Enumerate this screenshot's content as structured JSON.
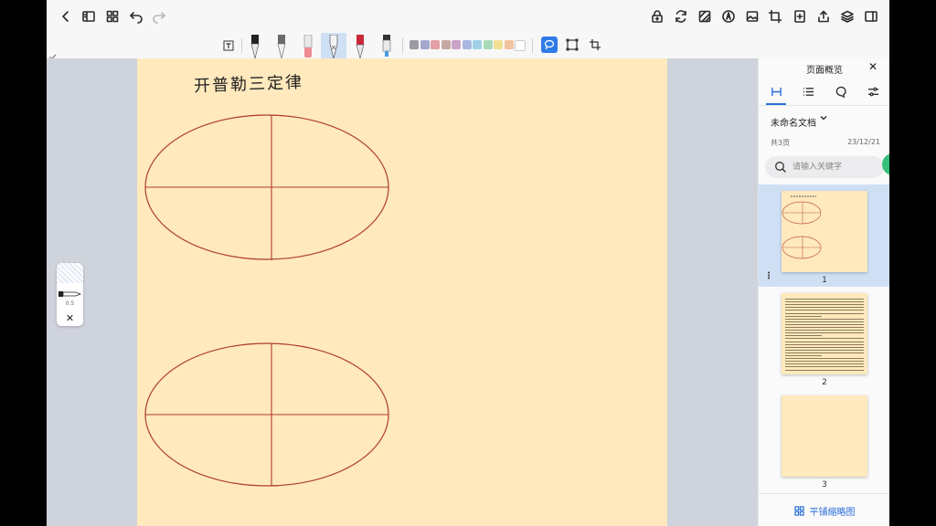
{
  "toolbar": {
    "top_icons_left": [
      "back-icon",
      "sidebar-icon",
      "grid-icon",
      "undo-icon",
      "redo-icon"
    ],
    "top_icons_right": [
      "lock-add-icon",
      "sync-icon",
      "template-icon",
      "pen-nib-icon",
      "image-icon",
      "crop-icon",
      "add-page-icon",
      "share-icon",
      "layers-icon",
      "panel-toggle-icon"
    ],
    "colors": [
      "#9a9ba3",
      "#a6a7cf",
      "#e3a1a6",
      "#c4a8a2",
      "#c9a3c6",
      "#a9b7e0",
      "#9ed1e6",
      "#a8dcb8",
      "#f0e094",
      "#f3c29f",
      "#ffffff"
    ]
  },
  "canvas": {
    "heading": "开普勒三定律",
    "stroke_color": "#b03d2c",
    "paper_color": "#ffe9bd"
  },
  "pen_widget": {
    "size_value": "0.5",
    "close": "✕"
  },
  "panel": {
    "title": "页面概览",
    "close": "✕",
    "doc_name": "未命名文档",
    "pages_count": "共3页",
    "date": "23/12/21",
    "search_placeholder": "请输入关键字",
    "pages": [
      {
        "number": "1",
        "selected": true
      },
      {
        "number": "2",
        "selected": false
      },
      {
        "number": "3",
        "selected": false
      }
    ],
    "bottom_label": "平铺缩略图"
  }
}
